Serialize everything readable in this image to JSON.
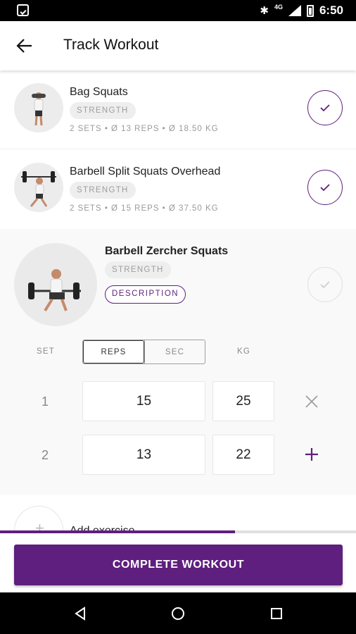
{
  "status_bar": {
    "time": "6:50",
    "network": "4G"
  },
  "app_bar": {
    "title": "Track Workout"
  },
  "exercises": [
    {
      "name": "Bag Squats",
      "tag": "STRENGTH",
      "meta": "2 SETS • Ø 13 REPS  • Ø 18.50 KG",
      "done": true
    },
    {
      "name": "Barbell Split Squats Overhead",
      "tag": "STRENGTH",
      "meta": "2 SETS • Ø 15 REPS  • Ø 37.50 KG",
      "done": true
    }
  ],
  "current_exercise": {
    "name": "Barbell Zercher Squats",
    "tag": "STRENGTH",
    "description_label": "DESCRIPTION",
    "columns": {
      "set": "SET",
      "reps": "REPS",
      "sec": "SEC",
      "kg": "KG"
    },
    "active_mode": "REPS",
    "sets": [
      {
        "set": "1",
        "reps": "15",
        "kg": "25",
        "action": "close-icon"
      },
      {
        "set": "2",
        "reps": "13",
        "kg": "22",
        "action": "plus-icon"
      }
    ]
  },
  "add_exercise": {
    "label": "Add exercise"
  },
  "progress": {
    "fraction": 0.66
  },
  "cta": {
    "label": "COMPLETE WORKOUT"
  },
  "colors": {
    "accent": "#5f1f7e",
    "tag_bg": "#eeeeee",
    "expanded_bg": "#f9f9f9"
  }
}
